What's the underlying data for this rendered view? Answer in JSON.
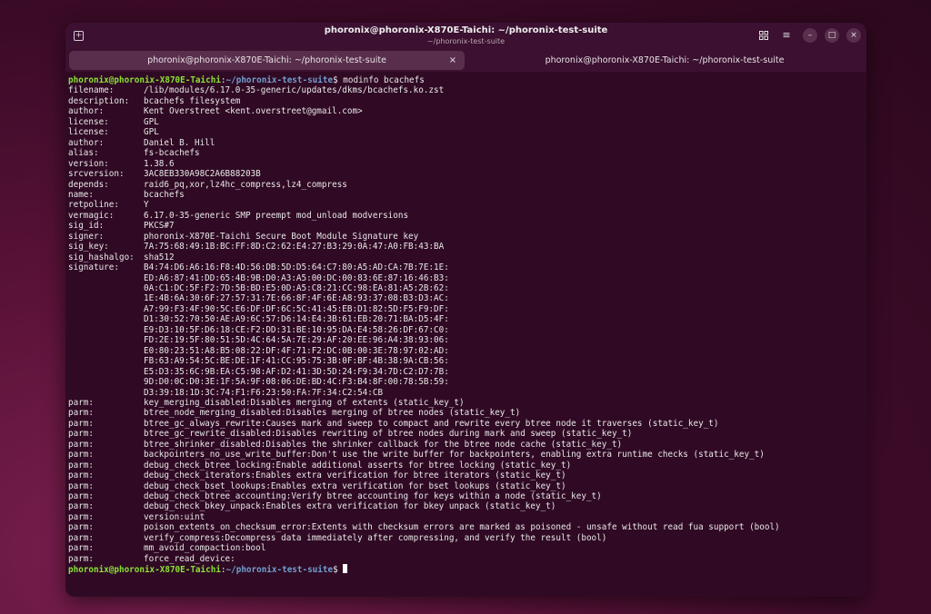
{
  "window": {
    "title": "phoronix@phoronix-X870E-Taichi: ~/phoronix-test-suite",
    "subtitle": "~/phoronix-test-suite",
    "buttons": [
      "new-tab",
      "tab-overview",
      "menu",
      "minimize",
      "maximize",
      "close"
    ]
  },
  "tabs": [
    {
      "label": "phoronix@phoronix-X870E-Taichi: ~/phoronix-test-suite",
      "active": true,
      "close_label": "×"
    },
    {
      "label": "phoronix@phoronix-X870E-Taichi: ~/phoronix-test-suite",
      "active": false
    }
  ],
  "prompt": {
    "user_host": "phoronix@phoronix-X870E-Taichi",
    "colon": ":",
    "path": "~/phoronix-test-suite",
    "symbol": "$",
    "command": " modinfo bcachefs"
  },
  "lines": [
    {
      "key": "filename:",
      "value": "/lib/modules/6.17.0-35-generic/updates/dkms/bcachefs.ko.zst"
    },
    {
      "key": "description:",
      "value": "bcachefs filesystem"
    },
    {
      "key": "author:",
      "value": "Kent Overstreet <kent.overstreet@gmail.com>"
    },
    {
      "key": "license:",
      "value": "GPL"
    },
    {
      "key": "license:",
      "value": "GPL"
    },
    {
      "key": "author:",
      "value": "Daniel B. Hill"
    },
    {
      "key": "alias:",
      "value": "fs-bcachefs"
    },
    {
      "key": "version:",
      "value": "1.38.6"
    },
    {
      "key": "srcversion:",
      "value": "3AC8EB330A98C2A6B88203B"
    },
    {
      "key": "depends:",
      "value": "raid6_pq,xor,lz4hc_compress,lz4_compress"
    },
    {
      "key": "name:",
      "value": "bcachefs"
    },
    {
      "key": "retpoline:",
      "value": "Y"
    },
    {
      "key": "vermagic:",
      "value": "6.17.0-35-generic SMP preempt mod_unload modversions"
    },
    {
      "key": "sig_id:",
      "value": "PKCS#7"
    },
    {
      "key": "signer:",
      "value": "phoronix-X870E-Taichi Secure Boot Module Signature key"
    },
    {
      "key": "sig_key:",
      "value": "7A:75:68:49:1B:BC:FF:8D:C2:62:E4:27:B3:29:0A:47:A0:FB:43:BA"
    },
    {
      "key": "sig_hashalgo:",
      "value": "sha512"
    },
    {
      "key": "signature:",
      "value": "B4:74:D6:A6:16:F8:4D:56:DB:5D:D5:64:C7:80:A5:AD:CA:7B:7E:1E:"
    },
    {
      "key": "",
      "value": "ED:A6:87:41:DD:65:4B:9B:D0:A3:A5:00:DC:00:83:6E:87:16:46:B3:"
    },
    {
      "key": "",
      "value": "0A:C1:DC:5F:F2:7D:5B:BD:E5:0D:A5:C8:21:CC:98:EA:81:A5:2B:62:"
    },
    {
      "key": "",
      "value": "1E:4B:6A:30:6F:27:57:31:7E:66:8F:4F:6E:A8:93:37:08:B3:D3:AC:"
    },
    {
      "key": "",
      "value": "A7:99:F3:4F:90:5C:E6:DF:DF:6C:5C:41:45:EB:D1:82:5D:F5:F9:DF:"
    },
    {
      "key": "",
      "value": "D1:30:52:70:50:AE:A9:6C:57:D6:14:E4:3B:61:EB:20:71:BA:D5:4F:"
    },
    {
      "key": "",
      "value": "E9:D3:10:5F:D6:18:CE:F2:DD:31:BE:10:95:DA:E4:58:26:DF:67:C0:"
    },
    {
      "key": "",
      "value": "FD:2E:19:5F:80:51:5D:4C:64:5A:7E:29:AF:20:EE:96:A4:38:93:06:"
    },
    {
      "key": "",
      "value": "E0:80:23:51:A8:B5:08:22:DF:4F:71:F2:DC:0B:00:3E:78:97:02:AD:"
    },
    {
      "key": "",
      "value": "FB:63:A9:54:5C:BE:DE:1F:41:CC:95:75:3B:0F:BF:4B:38:9A:CB:56:"
    },
    {
      "key": "",
      "value": "E5:D3:35:6C:9B:EA:C5:98:AF:D2:41:3D:5D:24:F9:34:7D:C2:D7:7B:"
    },
    {
      "key": "",
      "value": "9D:D0:0C:D0:3E:1F:5A:9F:08:06:DE:BD:4C:F3:B4:8F:00:78:5B:59:"
    },
    {
      "key": "",
      "value": "D3:39:18:1D:3C:74:F1:F6:23:50:FA:7F:34:C2:54:CB"
    },
    {
      "key": "parm:",
      "value": "key_merging_disabled:Disables merging of extents (static_key_t)"
    },
    {
      "key": "parm:",
      "value": "btree_node_merging_disabled:Disables merging of btree nodes (static_key_t)"
    },
    {
      "key": "parm:",
      "value": "btree_gc_always_rewrite:Causes mark and sweep to compact and rewrite every btree node it traverses (static_key_t)"
    },
    {
      "key": "parm:",
      "value": "btree_gc_rewrite_disabled:Disables rewriting of btree nodes during mark and sweep (static_key_t)"
    },
    {
      "key": "parm:",
      "value": "btree_shrinker_disabled:Disables the shrinker callback for the btree node cache (static_key_t)"
    },
    {
      "key": "parm:",
      "value": "backpointers_no_use_write_buffer:Don't use the write buffer for backpointers, enabling extra runtime checks (static_key_t)"
    },
    {
      "key": "parm:",
      "value": "debug_check_btree_locking:Enable additional asserts for btree locking (static_key_t)"
    },
    {
      "key": "parm:",
      "value": "debug_check_iterators:Enables extra verification for btree iterators (static_key_t)"
    },
    {
      "key": "parm:",
      "value": "debug_check_bset_lookups:Enables extra verification for bset lookups (static_key_t)"
    },
    {
      "key": "parm:",
      "value": "debug_check_btree_accounting:Verify btree accounting for keys within a node (static_key_t)"
    },
    {
      "key": "parm:",
      "value": "debug_check_bkey_unpack:Enables extra verification for bkey unpack (static_key_t)"
    },
    {
      "key": "parm:",
      "value": "version:uint"
    },
    {
      "key": "parm:",
      "value": "poison_extents_on_checksum_error:Extents with checksum errors are marked as poisoned - unsafe without read fua support (bool)"
    },
    {
      "key": "parm:",
      "value": "verify_compress:Decompress data immediately after compressing, and verify the result (bool)"
    },
    {
      "key": "parm:",
      "value": "mm_avoid_compaction:bool"
    },
    {
      "key": "parm:",
      "value": "force_read_device:"
    }
  ],
  "colors": {
    "terminal_bg": "#300a24",
    "prompt_user": "#8ae234",
    "prompt_path": "#729fcf",
    "text": "#e8e8e8"
  }
}
